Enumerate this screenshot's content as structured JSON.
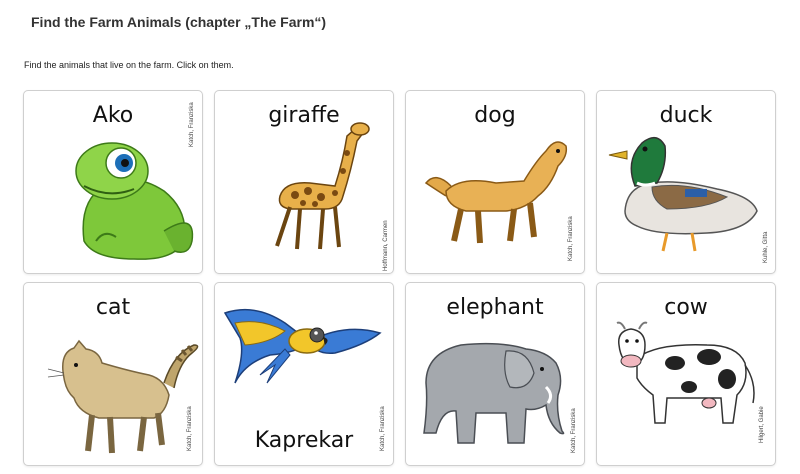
{
  "page": {
    "title": "Find the Farm Animals (chapter „The Farm“)",
    "instruction": "Find the animals that live on the farm. Click on them."
  },
  "cards": [
    {
      "label": "Ako",
      "credit": "Katch, Franziska",
      "icon": "chameleon"
    },
    {
      "label": "giraffe",
      "credit": "Hoffmann, Carmen",
      "icon": "giraffe"
    },
    {
      "label": "dog",
      "credit": "Katch, Franziska",
      "icon": "dog"
    },
    {
      "label": "duck",
      "credit": "Kuhle, Gitta",
      "icon": "duck"
    },
    {
      "label": "cat",
      "credit": "Katch, Franziska",
      "icon": "cat"
    },
    {
      "label": "Kaprekar",
      "credit": "Katch, Franziska",
      "icon": "parrot"
    },
    {
      "label": "elephant",
      "credit": "Katch, Franziska",
      "icon": "elephant"
    },
    {
      "label": "cow",
      "credit": "Hilgert, Gabie",
      "icon": "cow"
    }
  ],
  "colors": {
    "card_border": "#cfcfcf",
    "title_text": "#333333"
  }
}
